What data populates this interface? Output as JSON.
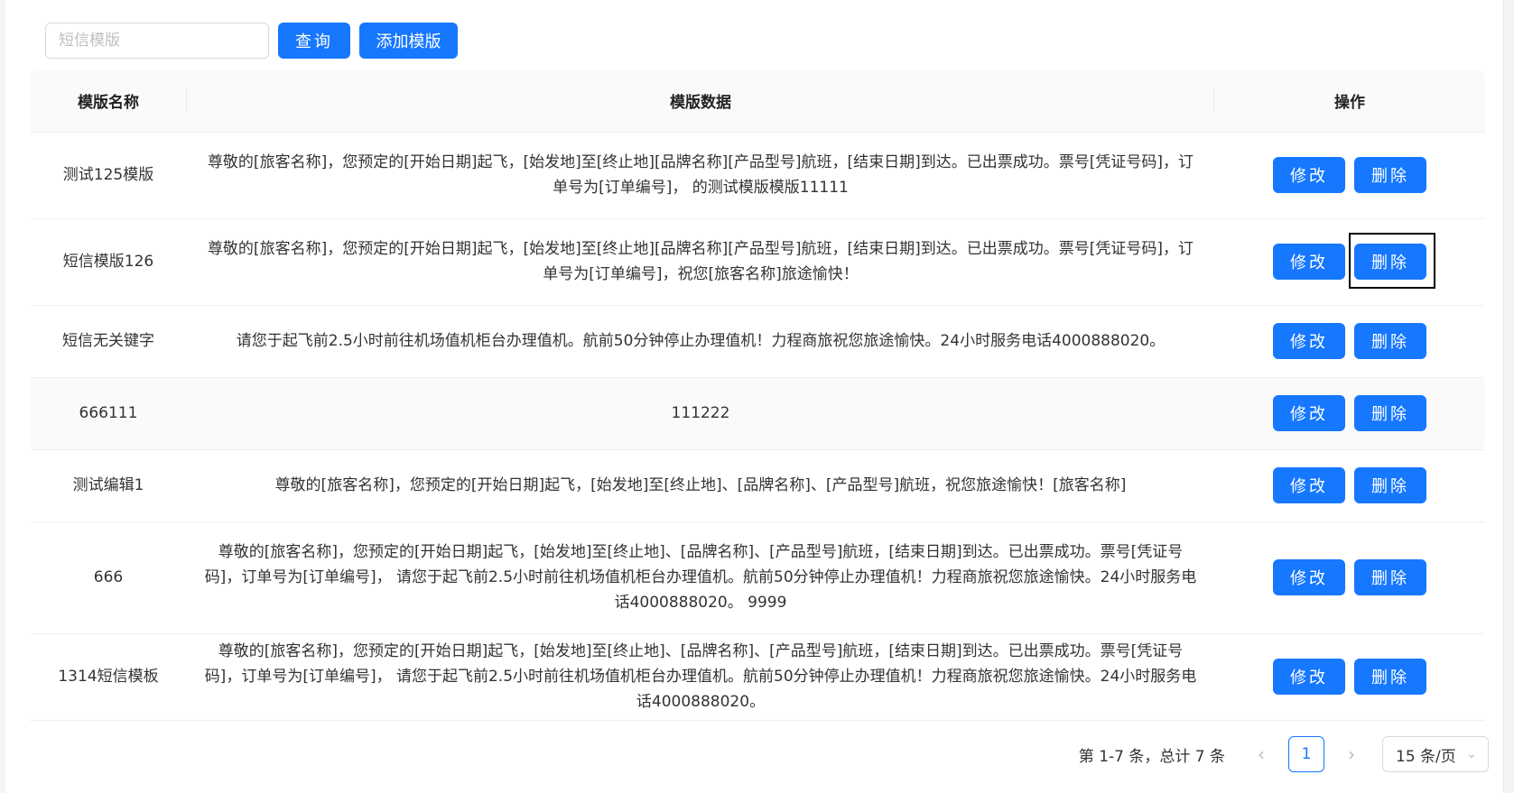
{
  "toolbar": {
    "search_placeholder": "短信模版",
    "query_label": "查询",
    "add_label": "添加模版"
  },
  "table": {
    "columns": [
      "模版名称",
      "模版数据",
      "操作"
    ],
    "rows": [
      {
        "name": "测试125模版",
        "data": "尊敬的[旅客名称]，您预定的[开始日期]起飞，[始发地]至[终止地][品牌名称][产品型号]航班，[结束日期]到达。已出票成功。票号[凭证号码]，订单号为[订单编号]， 的测试模版模版11111"
      },
      {
        "name": "短信模版126",
        "data": "尊敬的[旅客名称]，您预定的[开始日期]起飞，[始发地]至[终止地][品牌名称][产品型号]航班，[结束日期]到达。已出票成功。票号[凭证号码]，订单号为[订单编号]，祝您[旅客名称]旅途愉快！"
      },
      {
        "name": "短信无关键字",
        "data": "请您于起飞前2.5小时前往机场值机柜台办理值机。航前50分钟停止办理值机！力程商旅祝您旅途愉快。24小时服务电话4000888020。"
      },
      {
        "name": "666111",
        "data": "111222"
      },
      {
        "name": "测试编辑1",
        "data": "尊敬的[旅客名称]，您预定的[开始日期]起飞，[始发地]至[终止地]、[品牌名称]、[产品型号]航班，祝您旅途愉快！[旅客名称]"
      },
      {
        "name": "666",
        "data": "尊敬的[旅客名称]，您预定的[开始日期]起飞，[始发地]至[终止地]、[品牌名称]、[产品型号]航班，[结束日期]到达。已出票成功。票号[凭证号码]，订单号为[订单编号]， 请您于起飞前2.5小时前往机场值机柜台办理值机。航前50分钟停止办理值机！力程商旅祝您旅途愉快。24小时服务电话4000888020。 9999"
      },
      {
        "name": "1314短信模板",
        "data": "尊敬的[旅客名称]，您预定的[开始日期]起飞，[始发地]至[终止地]、[品牌名称]、[产品型号]航班，[结束日期]到达。已出票成功。票号[凭证号码]，订单号为[订单编号]， 请您于起飞前2.5小时前往机场值机柜台办理值机。航前50分钟停止办理值机！力程商旅祝您旅途愉快。24小时服务电话4000888020。"
      }
    ],
    "edit_label": "修改",
    "delete_label": "删除"
  },
  "pagination": {
    "total_text": "第 1-7 条，总计 7 条",
    "prev_icon": "‹",
    "current_page": "1",
    "next_icon": "›",
    "page_size": "15 条/页",
    "dropdown_icon": "chevron-down-icon"
  },
  "colors": {
    "primary": "#1677ff",
    "header_bg": "#fafafa",
    "border": "#f0f0f0"
  }
}
